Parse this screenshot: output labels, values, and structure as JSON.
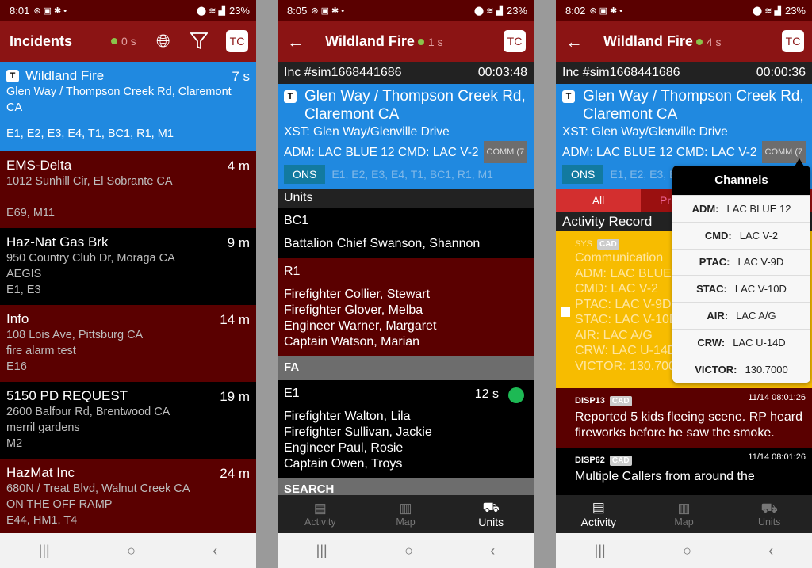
{
  "phone1": {
    "status": {
      "time": "8:01",
      "battery": "23%"
    },
    "appbar": {
      "title": "Incidents",
      "sync_age": "0 s",
      "avatar": "TC",
      "icons": [
        "globe-icon",
        "filter-icon"
      ]
    },
    "incidents": [
      {
        "name": "Wildland Fire",
        "time": "7 s",
        "address": "Glen Way / Thompson Creek Rd, Claremont CA",
        "note": "",
        "units": "E1, E2, E3, E4, T1, BC1, R1, M1",
        "badge": "T",
        "color": "blue"
      },
      {
        "name": "EMS-Delta",
        "time": "4 m",
        "address": "1012 Sunhill Cir, El Sobrante CA",
        "note": "",
        "units": "E69, M11",
        "color": "red"
      },
      {
        "name": "Haz-Nat Gas Brk",
        "time": "9 m",
        "address": "950 Country Club Dr, Moraga CA",
        "note": "AEGIS",
        "units": "E1, E3",
        "color": "black"
      },
      {
        "name": "Info",
        "time": "14 m",
        "address": "108 Lois Ave, Pittsburg CA",
        "note": "fire alarm test",
        "units": "E16",
        "color": "red"
      },
      {
        "name": "5150 PD REQUEST",
        "time": "19 m",
        "address": "2600 Balfour Rd, Brentwood CA",
        "note": "merril gardens",
        "units": "M2",
        "color": "black"
      },
      {
        "name": "HazMat Inc",
        "time": "24 m",
        "address": "680N / Treat Blvd, Walnut Creek CA",
        "note": "ON THE OFF RAMP",
        "units": "E44, HM1, T4",
        "color": "red"
      }
    ]
  },
  "phone2": {
    "status": {
      "time": "8:05",
      "battery": "23%"
    },
    "appbar": {
      "title": "Wildland Fire",
      "sync_age": "1 s",
      "avatar": "TC"
    },
    "inc_number": "Inc #sim1668441686",
    "elapsed": "00:03:48",
    "detail": {
      "badge": "T",
      "address": "Glen Way / Thompson Creek Rd, Claremont CA",
      "xst": "XST: Glen Way/Glenville Drive",
      "channels": "ADM: LAC BLUE 12  CMD: LAC V-2",
      "comm": "COMM (7",
      "ons": "ONS",
      "units": "E1, E2, E3, E4, T1, BC1, R1, M1"
    },
    "units_header": "Units",
    "units": [
      {
        "name": "BC1",
        "members": [
          "Battalion Chief Swanson, Shannon"
        ],
        "color": "black"
      },
      {
        "name": "R1",
        "members": [
          "Firefighter Collier, Stewart",
          "Firefighter Glover, Melba",
          "Engineer Warner, Margaret",
          "Captain Watson, Marian"
        ],
        "color": "red"
      }
    ],
    "group_fa": "FA",
    "fa_units": [
      {
        "name": "E1",
        "time": "12 s",
        "members": [
          "Firefighter Walton, Lila",
          "Firefighter Sullivan, Jackie",
          "Engineer Paul, Rosie",
          "Captain Owen, Troys"
        ],
        "status_color": "#1db954"
      }
    ],
    "group_search": "SEARCH",
    "tabs": [
      {
        "label": "Activity"
      },
      {
        "label": "Map"
      },
      {
        "label": "Units",
        "active": true
      }
    ]
  },
  "phone3": {
    "status": {
      "time": "8:02",
      "battery": "23%"
    },
    "appbar": {
      "title": "Wildland Fire",
      "sync_age": "4 s",
      "avatar": "TC"
    },
    "inc_number": "Inc #sim1668441686",
    "elapsed": "00:00:36",
    "detail": {
      "badge": "T",
      "address": "Glen Way / Thompson Creek Rd, Claremont CA",
      "xst": "XST: Glen Way/Glenville Drive",
      "channels": "ADM: LAC BLUE 12  CMD: LAC V-2",
      "comm": "COMM (7",
      "ons": "ONS",
      "units": "E1, E2, E3, E4"
    },
    "filters": {
      "all": "All",
      "pri": "Pri"
    },
    "activity_header": "Activity Record",
    "activities": [
      {
        "who": "SYS",
        "tag": "CAD",
        "stamp": "",
        "lines": [
          "Communication",
          "ADM: LAC BLUE",
          "CMD: LAC V-2",
          "PTAC: LAC V-9D",
          "STAC: LAC V-10D",
          "AIR: LAC A/G",
          "CRW: LAC U-14D",
          "VICTOR: 130.700"
        ],
        "color": "yellow"
      },
      {
        "who": "DISP13",
        "tag": "CAD",
        "stamp": "11/14 08:01:26",
        "lines": [
          "Reported 5 kids fleeing scene.  RP heard fireworks before he saw the smoke."
        ],
        "color": "red"
      },
      {
        "who": "DISP62",
        "tag": "CAD",
        "stamp": "11/14 08:01:26",
        "lines": [
          "Multiple Callers from around the"
        ],
        "color": "black"
      }
    ],
    "channels_popup": {
      "title": "Channels",
      "rows": [
        {
          "key": "ADM:",
          "value": "LAC BLUE 12"
        },
        {
          "key": "CMD:",
          "value": "LAC V-2"
        },
        {
          "key": "PTAC:",
          "value": "LAC V-9D"
        },
        {
          "key": "STAC:",
          "value": "LAC V-10D"
        },
        {
          "key": "AIR:",
          "value": "LAC A/G"
        },
        {
          "key": "CRW:",
          "value": "LAC U-14D"
        },
        {
          "key": "VICTOR:",
          "value": "130.7000"
        }
      ]
    },
    "tabs": [
      {
        "label": "Activity",
        "active": true
      },
      {
        "label": "Map"
      },
      {
        "label": "Units"
      }
    ]
  },
  "navbar": {
    "recents": "|||",
    "home": "○",
    "back": "‹"
  }
}
